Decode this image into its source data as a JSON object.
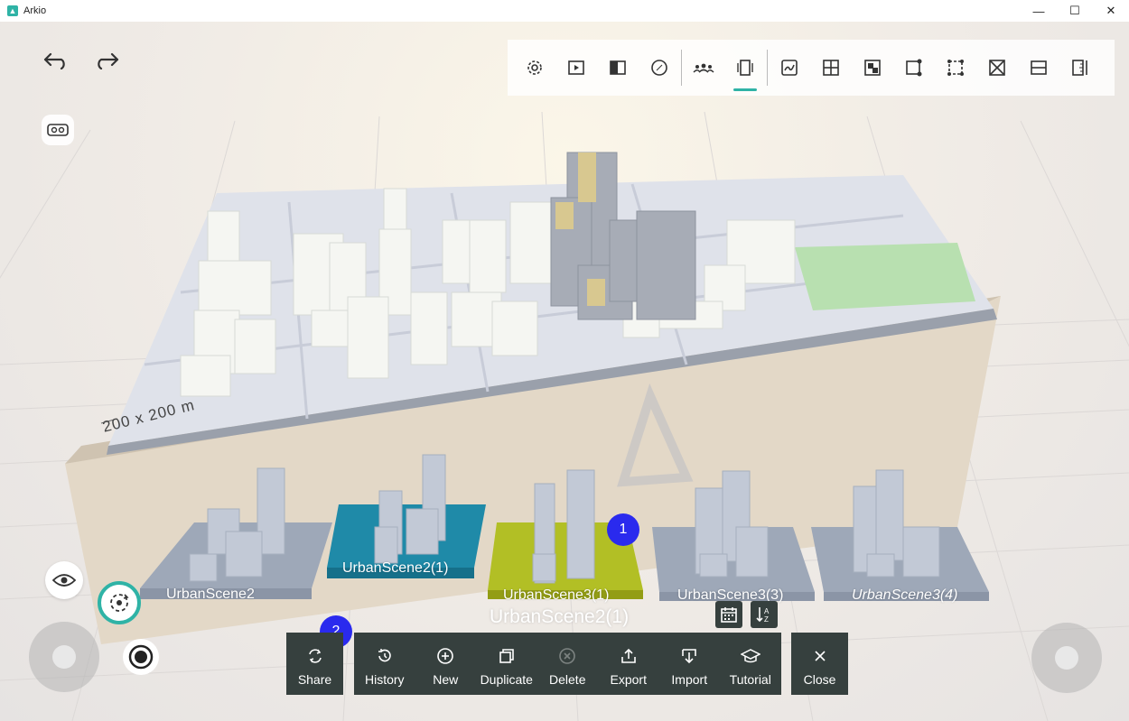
{
  "window": {
    "title": "Arkio",
    "controls": [
      "—",
      "☐",
      "✕"
    ]
  },
  "toolbar": {
    "undo_icon": "undo-icon",
    "redo_icon": "redo-icon",
    "tools": [
      {
        "name": "settings-icon"
      },
      {
        "name": "play-presentation-icon"
      },
      {
        "name": "split-view-icon"
      },
      {
        "name": "compass-icon"
      },
      {
        "name": "people-icon"
      },
      {
        "name": "phone-frame-icon",
        "active": true
      },
      {
        "name": "sketch-draw-icon"
      },
      {
        "name": "grid-split-icon"
      },
      {
        "name": "material-icon"
      },
      {
        "name": "edge-edit-icon"
      },
      {
        "name": "select-box-icon"
      },
      {
        "name": "delete-box-icon"
      },
      {
        "name": "split-horizontal-icon"
      },
      {
        "name": "measure-icon"
      }
    ],
    "accent_color": "#2fb3a6"
  },
  "viewport": {
    "scale_label": "200 x 200 m",
    "selected_scene_name": "UrbanScene2(1)"
  },
  "scenes": [
    {
      "label": "UrbanScene2",
      "tile_color": "#9ea8b8"
    },
    {
      "label": "UrbanScene2(1)",
      "tile_color": "#1f8aa8"
    },
    {
      "label": "UrbanScene3(1)",
      "tile_color": "#b2bf25"
    },
    {
      "label": "UrbanScene3(3)",
      "tile_color": "#9ea8b8"
    },
    {
      "label": "UrbanScene3(4)",
      "tile_color": "#9ea8b8"
    }
  ],
  "badges": [
    "1",
    "2"
  ],
  "menu": {
    "share": {
      "label": "Share",
      "icon": "share-cycle-icon"
    },
    "items": [
      {
        "label": "History",
        "icon": "history-icon"
      },
      {
        "label": "New",
        "icon": "plus-circle-icon"
      },
      {
        "label": "Duplicate",
        "icon": "duplicate-icon"
      },
      {
        "label": "Delete",
        "icon": "delete-circle-icon",
        "disabled": true
      },
      {
        "label": "Export",
        "icon": "export-icon"
      },
      {
        "label": "Import",
        "icon": "import-icon"
      },
      {
        "label": "Tutorial",
        "icon": "graduation-cap-icon"
      }
    ],
    "close": {
      "label": "Close",
      "icon": "close-icon"
    },
    "bg_color": "#36403e"
  },
  "sort_buttons": [
    {
      "icon": "calendar-sort-icon"
    },
    {
      "icon": "alpha-sort-icon"
    }
  ]
}
